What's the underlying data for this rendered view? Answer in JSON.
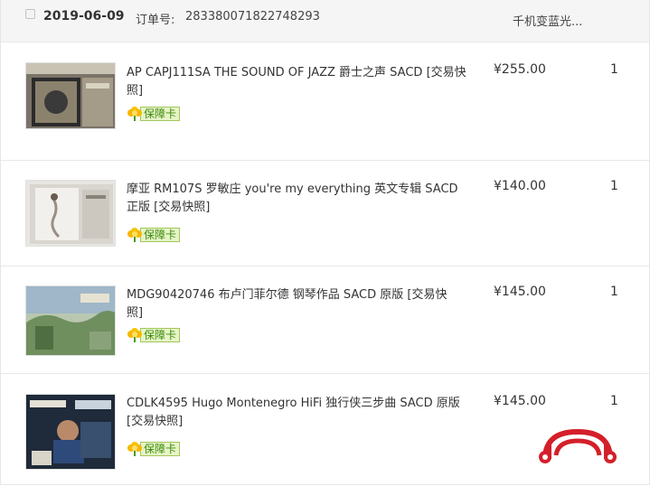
{
  "order": {
    "date": "2019-06-09",
    "number_label": "订单号:",
    "number": "283380071822748293",
    "shop": "千机变蓝光..."
  },
  "items": [
    {
      "title": "AP CAPJ111SA THE SOUND OF JAZZ 爵士之声 SACD [交易快照]",
      "badge": "保障卡",
      "price": "¥255.00",
      "qty": "1"
    },
    {
      "title": "摩亚 RM107S 罗敏庄 you're my everything 英文专辑 SACD 正版 [交易快照]",
      "badge": "保障卡",
      "price": "¥140.00",
      "qty": "1"
    },
    {
      "title": "MDG90420746 布卢门菲尔德 钢琴作品 SACD 原版 [交易快照]",
      "badge": "保障卡",
      "price": "¥145.00",
      "qty": "1"
    },
    {
      "title": "CDLK4595 Hugo Montenegro HiFi 独行侠三步曲 SACD 原版 [交易快照]",
      "badge": "保障卡",
      "price": "¥145.00",
      "qty": "1"
    }
  ],
  "colors": {
    "watermark": "#d4202a",
    "badge_green": "#3d8a0a"
  }
}
